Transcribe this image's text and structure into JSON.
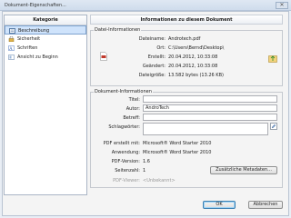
{
  "window": {
    "title": "Dokument-Eigenschaften...",
    "close_glyph": "✕"
  },
  "left": {
    "header": "Kategorie",
    "items": [
      {
        "label": "Beschreibung",
        "icon": "description-icon",
        "selected": true
      },
      {
        "label": "Sicherheit",
        "icon": "security-icon",
        "selected": false
      },
      {
        "label": "Schriften",
        "icon": "fonts-icon",
        "selected": false
      },
      {
        "label": "Ansicht zu Beginn",
        "icon": "initial-view-icon",
        "selected": false
      }
    ]
  },
  "right": {
    "header": "Informationen zu diesem Dokument",
    "file_info": {
      "group_label": "Datei-Informationen",
      "rows": [
        {
          "label": "Dateiname:",
          "value": "Androtech.pdf"
        },
        {
          "label": "Ort:",
          "value": "C:\\Users\\Bernd\\Desktop\\"
        },
        {
          "label": "Erstellt:",
          "value": "20.04.2012, 10:33:08"
        },
        {
          "label": "Geändert:",
          "value": "20.04.2012, 10:33:08"
        },
        {
          "label": "Dateigröße:",
          "value": "13.582 bytes (13.26 KB)"
        }
      ]
    },
    "doc_info": {
      "group_label": "Dokument-Informationen",
      "fields": [
        {
          "label": "Titel:",
          "value": ""
        },
        {
          "label": "Autor:",
          "value": "AndroTech"
        },
        {
          "label": "Betreff:",
          "value": ""
        },
        {
          "label": "Schlagwörter:",
          "value": ""
        }
      ],
      "static_rows": [
        {
          "label": "PDF erstellt mit:",
          "value": "Microsoft® Word Starter 2010"
        },
        {
          "label": "Anwendung:",
          "value": "Microsoft® Word Starter 2010"
        },
        {
          "label": "PDF-Version:",
          "value": "1.6"
        },
        {
          "label": "Seitenzahl:",
          "value": "1"
        },
        {
          "label": "PDF-Viewer:",
          "value": "<Unbekannt>"
        }
      ],
      "metadata_button": "Zusätzliche Metadaten..."
    }
  },
  "buttons": {
    "ok": "OK",
    "cancel": "Abbrechen"
  }
}
